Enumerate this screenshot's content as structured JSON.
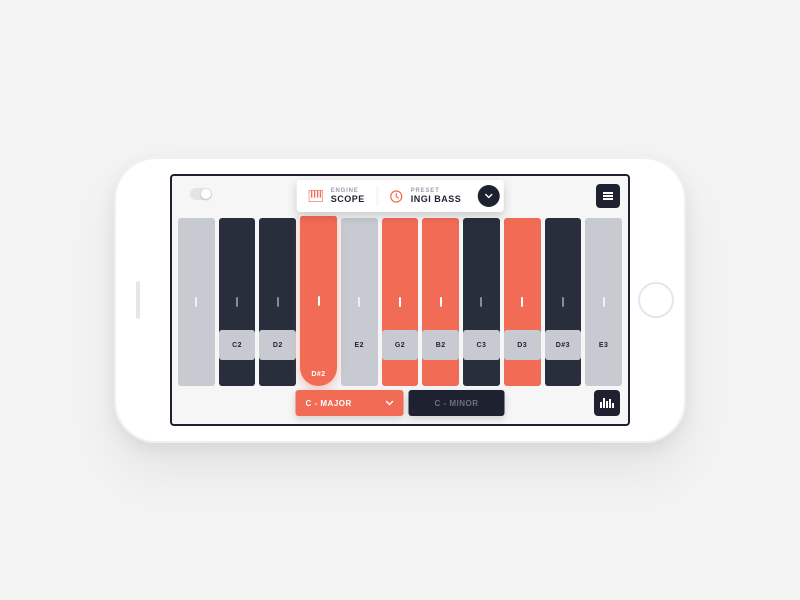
{
  "colors": {
    "accent": "#f26b55",
    "dark": "#1e2230",
    "grey": "#c7cbd1"
  },
  "header": {
    "engine": {
      "label": "ENGINE",
      "value": "SCOPE",
      "icon": "piano-icon"
    },
    "preset": {
      "label": "PRESET",
      "value": "INGI BASS",
      "icon": "clock-icon"
    },
    "dropdown_icon": "chevron-down-icon",
    "menu_icon": "hamburger-icon",
    "power_icon": "toggle-icon"
  },
  "pads": [
    {
      "state": "edge"
    },
    {
      "state": "dark"
    },
    {
      "state": "dark"
    },
    {
      "state": "accent-big",
      "label": "D#2"
    },
    {
      "state": "light"
    },
    {
      "state": "accent"
    },
    {
      "state": "accent"
    },
    {
      "state": "dark"
    },
    {
      "state": "accent"
    },
    {
      "state": "dark"
    },
    {
      "state": "edge"
    }
  ],
  "labels": [
    "",
    "C2",
    "D2",
    "D#2",
    "E2",
    "G2",
    "B2",
    "C3",
    "D3",
    "D#3",
    "E3",
    ""
  ],
  "scales": {
    "active": "C - MAJOR",
    "inactive": "C - MINOR"
  },
  "footer": {
    "fx_icon": "equalizer-icon"
  }
}
